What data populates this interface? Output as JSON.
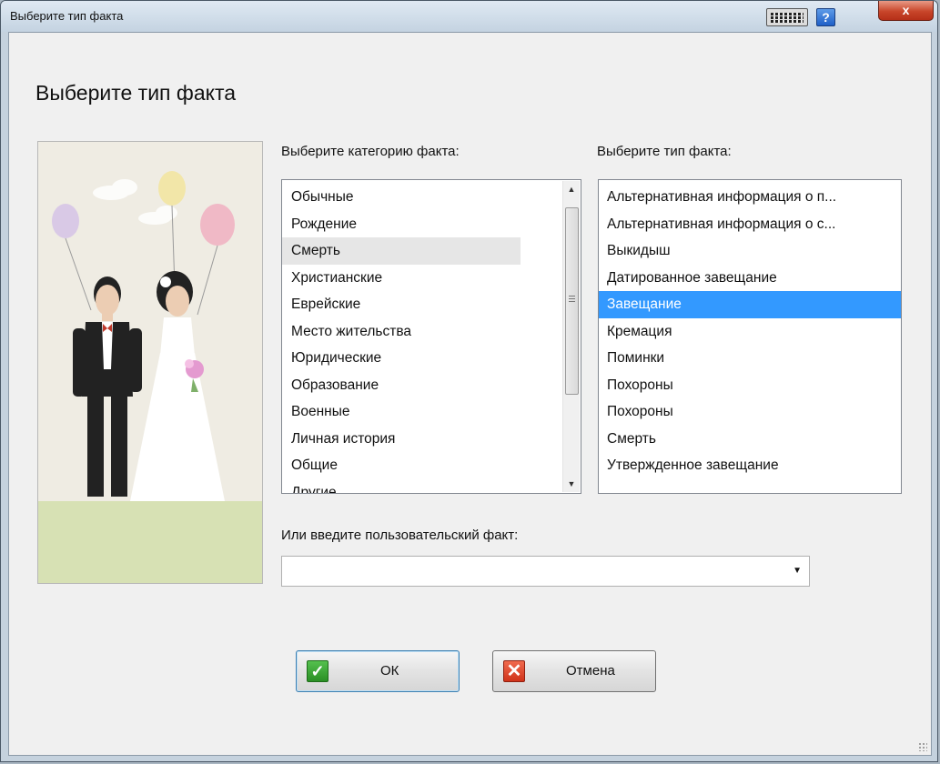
{
  "window": {
    "title": "Выберите тип факта"
  },
  "titlebar_buttons": {
    "help": "?",
    "close": "x"
  },
  "heading": "Выберите тип факта",
  "category": {
    "label": "Выберите категорию факта:",
    "items": [
      "Обычные",
      "Рождение",
      "Смерть",
      "Христианские",
      "Еврейские",
      "Место жительства",
      "Юридические",
      "Образование",
      "Военные",
      "Личная история",
      "Общие",
      "Другие"
    ],
    "highlighted": "Смерть"
  },
  "fact_type": {
    "label": "Выберите тип факта:",
    "items": [
      "Альтернативная информация о п...",
      "Альтернативная информация о с...",
      "Выкидыш",
      "Датированное завещание",
      "Завещание",
      "Кремация",
      "Поминки",
      "Похороны",
      "Похороны",
      "Смерть",
      "Утвержденное завещание"
    ],
    "selected": "Завещание"
  },
  "custom_fact": {
    "label": "Или введите пользовательский факт:",
    "value": ""
  },
  "buttons": {
    "ok": "ОК",
    "cancel": "Отмена"
  },
  "icons": {
    "keyboard": "keyboard-icon",
    "help": "help-icon",
    "close": "close-icon",
    "ok": "checkmark-icon",
    "cancel": "x-icon",
    "dropdown": "chevron-down-icon"
  },
  "colors": {
    "selection": "#3399ff",
    "hover": "#e6e6e6",
    "close_button": "#c8452a",
    "ok_icon": "#2a8f24",
    "cancel_icon": "#d0331a"
  }
}
